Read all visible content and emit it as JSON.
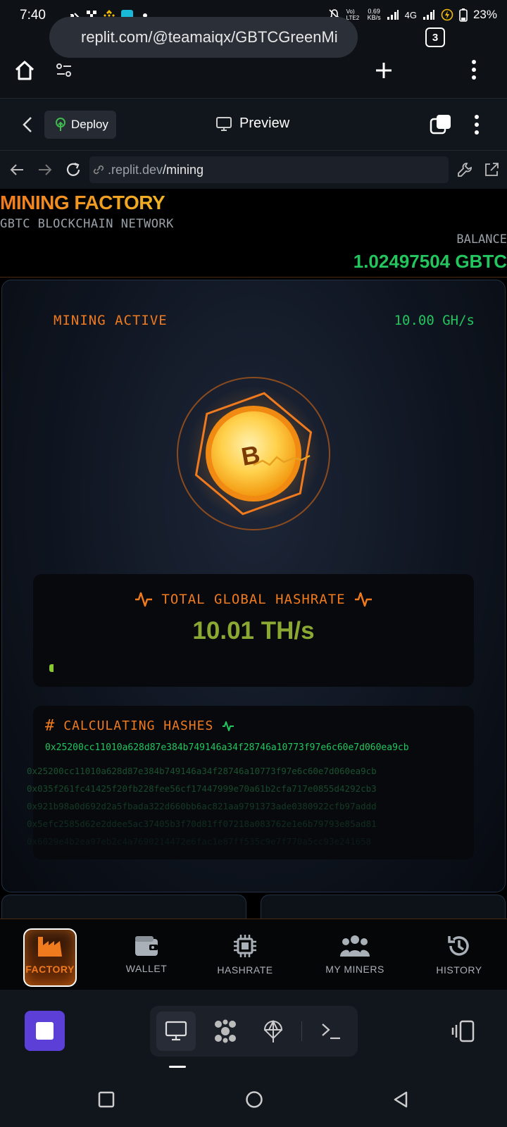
{
  "status_bar": {
    "time": "7:40",
    "net_volte": "Vo) LTE2",
    "net_speed_value": "0.69",
    "net_speed_unit": "KB/s",
    "net_type": "4G",
    "battery": "23%"
  },
  "browser": {
    "url": "replit.com/@teamaiqx/GBTCGreenMi",
    "tab_count": "3"
  },
  "replit_header": {
    "deploy_label": "Deploy",
    "preview_label": "Preview"
  },
  "webview": {
    "url_prefix": ".replit.dev",
    "url_path": "/mining"
  },
  "app": {
    "title": "MINING FACTORY",
    "subtitle": "GBTC BLOCKCHAIN NETWORK",
    "balance_label": "BALANCE",
    "balance_value": "1.02497504 GBTC",
    "mining_status": "MINING ACTIVE",
    "personal_hashrate": "10.00 GH/s",
    "coin_symbol": "B",
    "global_hashrate": {
      "label": "TOTAL GLOBAL HASHRATE",
      "value": "10.01 TH/s"
    },
    "hashes": {
      "title": "CALCULATING HASHES",
      "current": "0x25200cc11010a628d87e384b749146a34f28746a10773f97e6c60e7d060ea9cb",
      "history": [
        "0x25200cc11010a628d87e384b749146a34f28746a10773f97e6c60e7d060ea9cb",
        "0x035f261fc41425f20fb228fee56cf17447999e70a61b2cfa717e0855d4292cb3",
        "0x921b98a0d692d2a5fbada322d660bb6ac821aa9791373ade0380922cfb97addd",
        "0x5efc2585d62e2ddee5ac37405b3f70d81ff07218a083762e1e6b79793e85ad81",
        "0x6029e4b2ea97eb2c4a7690214472e6fac1e87ff535c9e7f770a5cc93e241658"
      ]
    },
    "nav": [
      {
        "label": "FACTORY"
      },
      {
        "label": "WALLET"
      },
      {
        "label": "HASHRATE"
      },
      {
        "label": "MY MINERS"
      },
      {
        "label": "HISTORY"
      }
    ]
  },
  "colors": {
    "accent_orange": "#f07a1e",
    "accent_green": "#22c55e",
    "replit_stop": "#5b3fd6"
  }
}
